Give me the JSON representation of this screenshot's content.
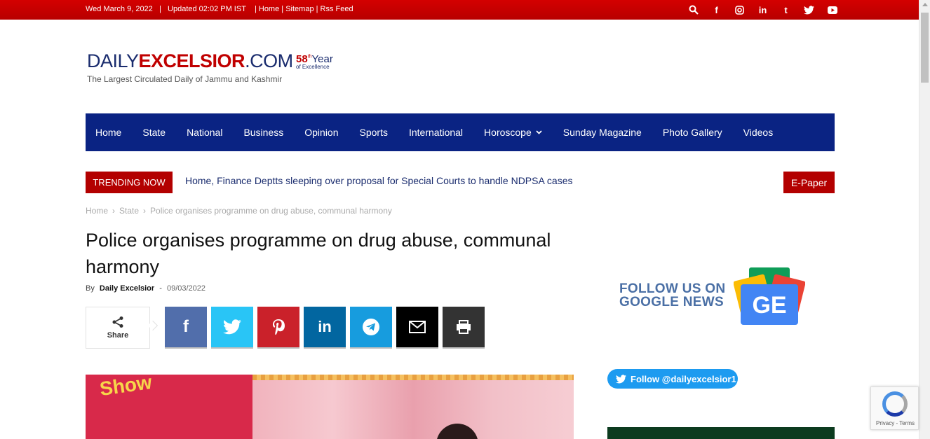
{
  "topbar": {
    "date": "Wed March 9, 2022",
    "updated": "Updated 02:02 PM IST",
    "links": [
      "Home",
      "Sitemap",
      "Rss Feed"
    ],
    "icons": [
      "search-icon",
      "facebook-icon",
      "instagram-icon",
      "linkedin-icon",
      "tumblr-icon",
      "twitter-icon",
      "youtube-icon"
    ],
    "color": "#c00000"
  },
  "logo": {
    "daily": "DAILY",
    "excelsior": "EXCELSIOR",
    "com": ".COM",
    "years_number": "58",
    "years_sup": "th",
    "years_word": "Year",
    "years_sub": "of Excellence",
    "tagline": "The Largest Circulated Daily of Jammu and Kashmir"
  },
  "nav": {
    "items": [
      "Home",
      "State",
      "National",
      "Business",
      "Opinion",
      "Sports",
      "International",
      "Horoscope",
      "Sunday Magazine",
      "Photo Gallery",
      "Videos"
    ],
    "color": "#0a2383"
  },
  "trending": {
    "label": "TRENDING NOW",
    "headline": "Home, Finance Deptts sleeping over proposal for Special Courts to handle NDPSA cases",
    "epaper": "E-Paper"
  },
  "breadcrumb": [
    "Home",
    "State",
    "Police organises programme on drug abuse, communal harmony"
  ],
  "article": {
    "title": "Police organises programme on drug abuse, communal harmony",
    "by": "By",
    "author": "Daily Excelsior",
    "dash": "-",
    "date": "09/03/2022",
    "image_text": "Show"
  },
  "share": {
    "label": "Share",
    "buttons": [
      {
        "name": "facebook",
        "icon": "facebook-icon",
        "glyph": "f",
        "color": "#516eab"
      },
      {
        "name": "twitter",
        "icon": "twitter-icon",
        "glyph": "🐦",
        "color": "#29c5f6"
      },
      {
        "name": "pinterest",
        "icon": "pinterest-icon",
        "glyph": "P",
        "color": "#ca212a"
      },
      {
        "name": "linkedin",
        "icon": "linkedin-icon",
        "glyph": "in",
        "color": "#0266a0"
      },
      {
        "name": "telegram",
        "icon": "telegram-icon",
        "glyph": "➤",
        "color": "#179cde"
      },
      {
        "name": "email",
        "icon": "email-icon",
        "glyph": "✉",
        "color": "#000000"
      },
      {
        "name": "print",
        "icon": "print-icon",
        "glyph": "⎙",
        "color": "#333333"
      }
    ]
  },
  "sidebar": {
    "follow_line1": "FOLLOW US ON",
    "follow_line2": "GOOGLE NEWS",
    "gnews_letters": "GE",
    "twitter_follow": "Follow @dailyexcelsior1"
  },
  "recaptcha": {
    "text": "Privacy - Terms"
  }
}
